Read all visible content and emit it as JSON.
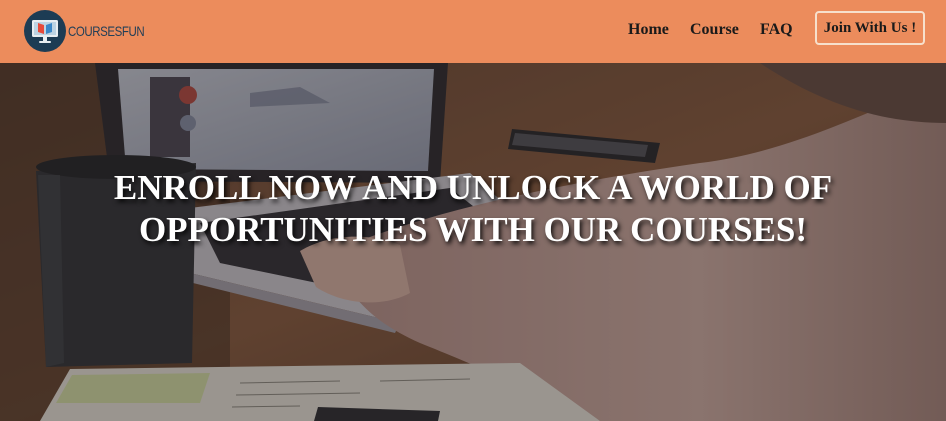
{
  "brand": {
    "logo_text": "COURSESFUN",
    "logo_icon": "monitor-book-icon"
  },
  "nav": {
    "items": [
      "Home",
      "Course",
      "FAQ"
    ],
    "cta_label": "Join With Us !"
  },
  "hero": {
    "title_line1": "ENROLL NOW AND UNLOCK A WORLD OF",
    "title_line2": "OPPORTUNITIES WITH OUR COURSES!"
  },
  "colors": {
    "navbar": "#ec8c5c",
    "logo_navy": "#1d3c54",
    "nav_text": "#1a1a1a",
    "cta_border": "#f7e0cc",
    "hero_text": "#ffffff"
  }
}
